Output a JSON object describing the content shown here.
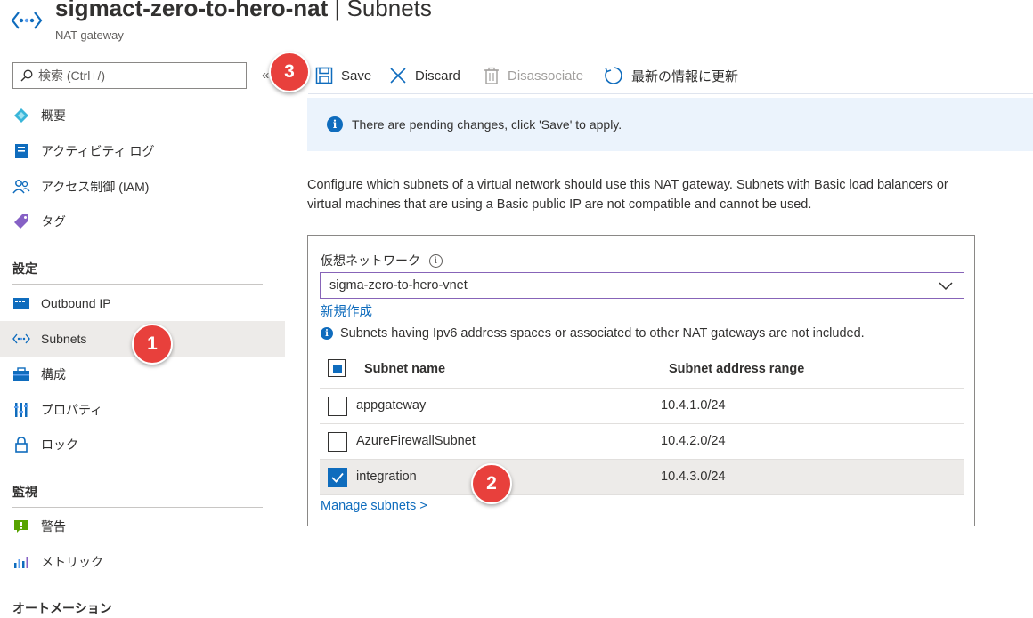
{
  "header": {
    "resource_name": "sigmact-zero-to-hero-nat",
    "separator": "|",
    "page_name": "Subnets",
    "resource_type": "NAT gateway"
  },
  "sidebar": {
    "search_placeholder": "検索 (Ctrl+/)",
    "collapse_glyph": "«",
    "items_top": [
      {
        "label": "概要",
        "icon": "overview-icon"
      },
      {
        "label": "アクティビティ ログ",
        "icon": "activity-log-icon"
      },
      {
        "label": "アクセス制御 (IAM)",
        "icon": "iam-icon"
      },
      {
        "label": "タグ",
        "icon": "tag-icon"
      }
    ],
    "section_settings": "設定",
    "items_settings": [
      {
        "label": "Outbound IP",
        "icon": "outbound-ip-icon"
      },
      {
        "label": "Subnets",
        "icon": "subnets-icon"
      },
      {
        "label": "構成",
        "icon": "configuration-icon"
      },
      {
        "label": "プロパティ",
        "icon": "properties-icon"
      },
      {
        "label": "ロック",
        "icon": "lock-icon"
      }
    ],
    "section_monitoring": "監視",
    "items_monitoring": [
      {
        "label": "警告",
        "icon": "alert-icon"
      },
      {
        "label": "メトリック",
        "icon": "metrics-icon"
      }
    ],
    "section_automation": "オートメーション"
  },
  "toolbar": {
    "save": "Save",
    "discard": "Discard",
    "disassociate": "Disassociate",
    "refresh": "最新の情報に更新"
  },
  "banner": {
    "text": "There are pending changes, click 'Save' to apply."
  },
  "description": "Configure which subnets of a virtual network should use this NAT gateway. Subnets with Basic load balancers or virtual machines that are using a Basic public IP are not compatible and cannot be used.",
  "panel": {
    "vnet_label": "仮想ネットワーク",
    "vnet_value": "sigma-zero-to-hero-vnet",
    "create_new": "新規作成",
    "note": "Subnets having Ipv6 address spaces or associated to other NAT gateways are not included.",
    "col_name": "Subnet name",
    "col_range": "Subnet address range",
    "rows": [
      {
        "name": "appgateway",
        "range": "10.4.1.0/24",
        "checked": false
      },
      {
        "name": "AzureFirewallSubnet",
        "range": "10.4.2.0/24",
        "checked": false
      },
      {
        "name": "integration",
        "range": "10.4.3.0/24",
        "checked": true
      }
    ],
    "manage_link": "Manage subnets >"
  },
  "badges": {
    "b1": "1",
    "b2": "2",
    "b3": "3"
  },
  "colors": {
    "accent": "#0f6cbd",
    "badge": "#e8403c",
    "banner_bg": "#ebf3fc"
  }
}
